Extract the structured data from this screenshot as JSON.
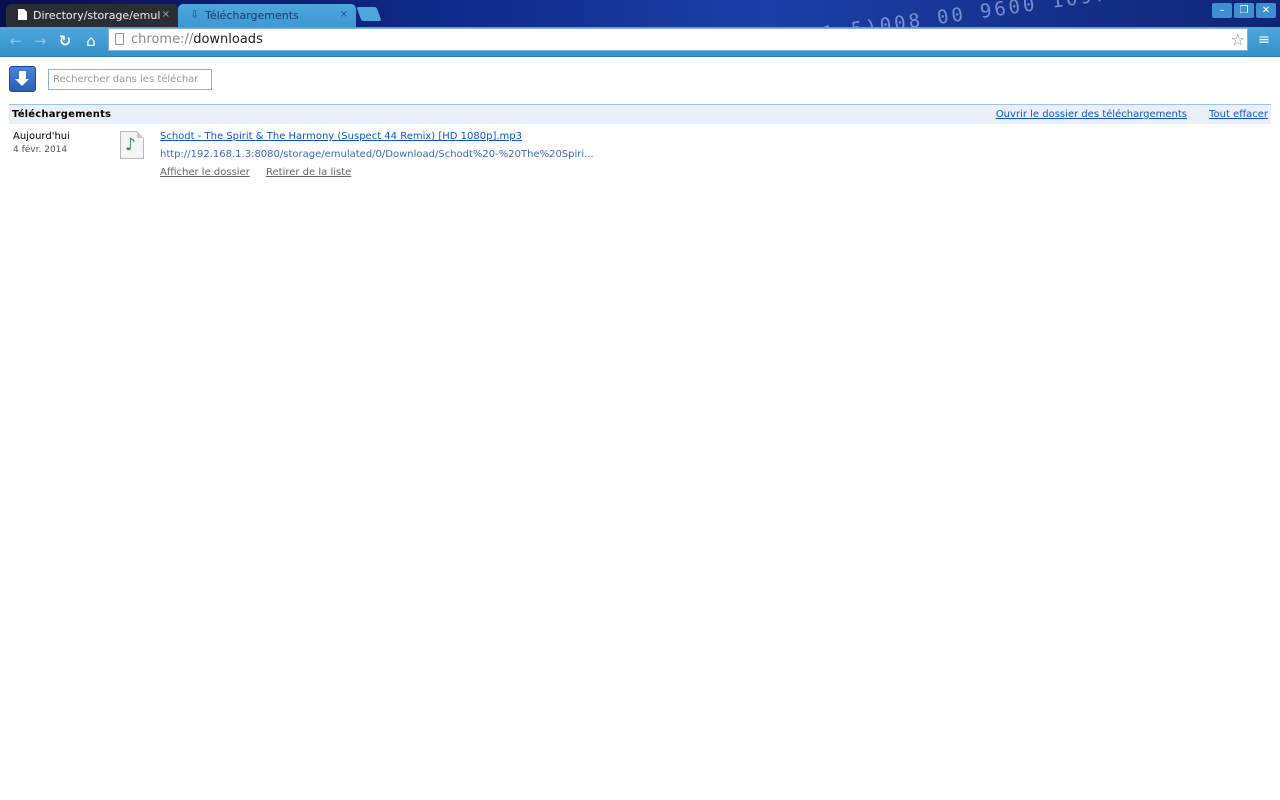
{
  "browser": {
    "tabs": [
      {
        "title": "Directory/storage/emul",
        "close": "×"
      },
      {
        "title": "Téléchargements",
        "close": "×"
      }
    ],
    "window_controls": {
      "minimize": "–",
      "maximize": "❐",
      "close": "✕"
    },
    "toolbar": {
      "back": "←",
      "forward": "→",
      "reload": "↻",
      "home": "⌂",
      "url_scheme": "chrome://",
      "url_path": "downloads",
      "star": "☆",
      "menu": "≡"
    }
  },
  "page": {
    "search": {
      "placeholder": "Rechercher dans les téléchar",
      "value": ""
    },
    "header": {
      "title": "Téléchargements",
      "open_folder_link": "Ouvrir le dossier des téléchargements",
      "clear_all_link": "Tout effacer"
    },
    "downloads": [
      {
        "day_label": "Aujourd'hui",
        "date": "4 févr. 2014",
        "file_name": "Schodt - The Spirit & The Harmony (Suspect 44 Remix) [HD 1080p].mp3",
        "url": "http://192.168.1.3:8080/storage/emulated/0/Download/Schodt%20-%20The%20Spiri...",
        "show_in_folder": "Afficher le dossier",
        "remove_from_list": "Retirer de la liste",
        "icon": "music-file-icon"
      }
    ]
  },
  "colors": {
    "accent": "#3d98d2",
    "link": "#1155cc",
    "header_bg": "#ebeff9"
  }
}
